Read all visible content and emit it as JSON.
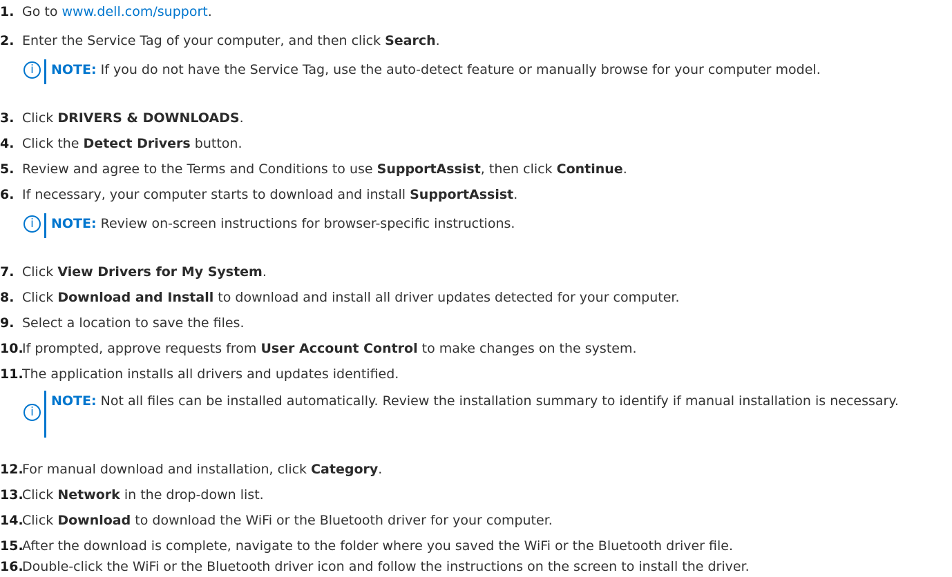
{
  "steps": [
    {
      "num": "1.",
      "parts": [
        {
          "t": "Go to "
        },
        {
          "t": "www.dell.com/support",
          "link": true
        },
        {
          "t": "."
        }
      ]
    },
    {
      "num": "2.",
      "parts": [
        {
          "t": "Enter the Service Tag of your computer, and then click "
        },
        {
          "t": "Search",
          "b": true
        },
        {
          "t": "."
        }
      ]
    },
    {
      "num": "3.",
      "parts": [
        {
          "t": "Click "
        },
        {
          "t": "DRIVERS & DOWNLOADS",
          "b": true
        },
        {
          "t": "."
        }
      ]
    },
    {
      "num": "4.",
      "parts": [
        {
          "t": "Click the "
        },
        {
          "t": "Detect Drivers",
          "b": true
        },
        {
          "t": " button."
        }
      ]
    },
    {
      "num": "5.",
      "parts": [
        {
          "t": "Review and agree to the Terms and Conditions to use "
        },
        {
          "t": "SupportAssist",
          "b": true
        },
        {
          "t": ", then click "
        },
        {
          "t": "Continue",
          "b": true
        },
        {
          "t": "."
        }
      ]
    },
    {
      "num": "6.",
      "parts": [
        {
          "t": "If necessary, your computer starts to download and install "
        },
        {
          "t": "SupportAssist",
          "b": true
        },
        {
          "t": "."
        }
      ]
    },
    {
      "num": "7.",
      "parts": [
        {
          "t": "Click "
        },
        {
          "t": "View Drivers for My System",
          "b": true
        },
        {
          "t": "."
        }
      ]
    },
    {
      "num": "8.",
      "parts": [
        {
          "t": "Click "
        },
        {
          "t": "Download and Install",
          "b": true
        },
        {
          "t": " to download and install all driver updates detected for your computer."
        }
      ]
    },
    {
      "num": "9.",
      "parts": [
        {
          "t": "Select a location to save the files."
        }
      ]
    },
    {
      "num": "10.",
      "parts": [
        {
          "t": "If prompted, approve requests from "
        },
        {
          "t": "User Account Control",
          "b": true
        },
        {
          "t": " to make changes on the system."
        }
      ]
    },
    {
      "num": "11.",
      "parts": [
        {
          "t": "The application installs all drivers and updates identified."
        }
      ]
    },
    {
      "num": "12.",
      "parts": [
        {
          "t": "For manual download and installation, click "
        },
        {
          "t": "Category",
          "b": true
        },
        {
          "t": "."
        }
      ]
    },
    {
      "num": "13.",
      "parts": [
        {
          "t": "Click "
        },
        {
          "t": "Network",
          "b": true
        },
        {
          "t": " in the drop-down list."
        }
      ]
    },
    {
      "num": "14.",
      "parts": [
        {
          "t": "Click "
        },
        {
          "t": "Download",
          "b": true
        },
        {
          "t": " to download the WiFi or the Bluetooth driver for your computer."
        }
      ]
    },
    {
      "num": "15.",
      "parts": [
        {
          "t": "After the download is complete, navigate to the folder where you saved the WiFi or the Bluetooth driver file."
        }
      ]
    },
    {
      "num": "16.",
      "parts": [
        {
          "t": "Double-click the WiFi or the Bluetooth driver icon and follow the instructions on the screen to install the driver."
        }
      ]
    }
  ],
  "notes": [
    {
      "label": "NOTE:",
      "text": " If you do not have the Service Tag, use the auto-detect feature or manually browse for your computer model.",
      "icon": "info-icon"
    },
    {
      "label": "NOTE:",
      "text": " Review on-screen instructions for browser-specific instructions.",
      "icon": "info-icon"
    },
    {
      "label": "NOTE:",
      "text": " Not all files can be installed automatically. Review the installation summary to identify if manual installation is necessary.",
      "icon": "info-icon"
    }
  ],
  "colors": {
    "accent": "#0076ce",
    "text": "#333333"
  }
}
